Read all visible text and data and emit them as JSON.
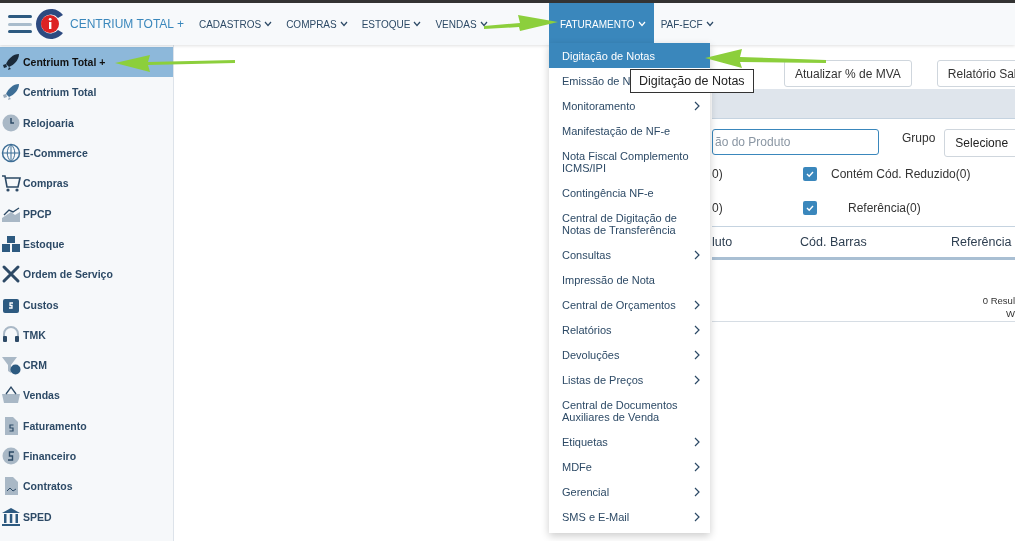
{
  "top_nav": {
    "brand": "CENTRIUM TOTAL +",
    "menus": [
      {
        "label": "CADASTROS",
        "selected": false
      },
      {
        "label": "COMPRAS",
        "selected": false
      },
      {
        "label": "ESTOQUE",
        "selected": false
      },
      {
        "label": "VENDAS",
        "selected": false
      },
      {
        "label": "FATURAMENTO",
        "selected": true
      },
      {
        "label": "PAF-ECF",
        "selected": false
      }
    ]
  },
  "sidebar": {
    "items": [
      {
        "label": "Centrium Total +",
        "selected": true
      },
      {
        "label": "Centrium Total",
        "selected": false
      },
      {
        "label": "Relojoaria",
        "selected": false
      },
      {
        "label": "E-Commerce",
        "selected": false
      },
      {
        "label": "Compras",
        "selected": false
      },
      {
        "label": "PPCP",
        "selected": false
      },
      {
        "label": "Estoque",
        "selected": false
      },
      {
        "label": "Ordem de Serviço",
        "selected": false
      },
      {
        "label": "Custos",
        "selected": false
      },
      {
        "label": "TMK",
        "selected": false
      },
      {
        "label": "CRM",
        "selected": false
      },
      {
        "label": "Vendas",
        "selected": false
      },
      {
        "label": "Faturamento",
        "selected": false
      },
      {
        "label": "Financeiro",
        "selected": false
      },
      {
        "label": "Contratos",
        "selected": false
      },
      {
        "label": "SPED",
        "selected": false
      }
    ]
  },
  "toolbar": {
    "buttons": [
      "Atualizar % de MVA",
      "Relatório Sal"
    ]
  },
  "filters": {
    "search_placeholder": "ão do Produto",
    "group_label": "Grupo",
    "group_value": "Selecione",
    "checks": [
      {
        "count": "0)",
        "label": "Contém Cód. Reduzido(0)",
        "checked": true
      },
      {
        "count": "0)",
        "label": "Referência(0)",
        "checked": true
      }
    ]
  },
  "table": {
    "columns": [
      "luto",
      "Cód. Barras",
      "Referência"
    ],
    "footer": [
      "0 Resul",
      "W"
    ]
  },
  "dropdown": {
    "items": [
      {
        "label": "Digitação de Notas",
        "selected": true,
        "submenu": false
      },
      {
        "label": "Emissão de N",
        "selected": false,
        "submenu": false
      },
      {
        "label": "Monitoramento",
        "selected": false,
        "submenu": true
      },
      {
        "label": "Manifestação de NF-e",
        "selected": false,
        "submenu": false
      },
      {
        "label": "Nota Fiscal Complemento ICMS/IPI",
        "selected": false,
        "submenu": false
      },
      {
        "label": "Contingência NF-e",
        "selected": false,
        "submenu": false
      },
      {
        "label": "Central de Digitação de Notas de Transferência",
        "selected": false,
        "submenu": false
      },
      {
        "label": "Consultas",
        "selected": false,
        "submenu": true
      },
      {
        "label": "Impressão de Nota",
        "selected": false,
        "submenu": false
      },
      {
        "label": "Central de Orçamentos",
        "selected": false,
        "submenu": true
      },
      {
        "label": "Relatórios",
        "selected": false,
        "submenu": true
      },
      {
        "label": "Devoluções",
        "selected": false,
        "submenu": true
      },
      {
        "label": "Listas de Preços",
        "selected": false,
        "submenu": true
      },
      {
        "label": "Central de Documentos Auxiliares de Venda",
        "selected": false,
        "submenu": false
      },
      {
        "label": "Etiquetas",
        "selected": false,
        "submenu": true
      },
      {
        "label": "MDFe",
        "selected": false,
        "submenu": true
      },
      {
        "label": "Gerencial",
        "selected": false,
        "submenu": true
      },
      {
        "label": "SMS e E-Mail",
        "selected": false,
        "submenu": true
      }
    ]
  },
  "tooltip": "Digitação de Notas"
}
